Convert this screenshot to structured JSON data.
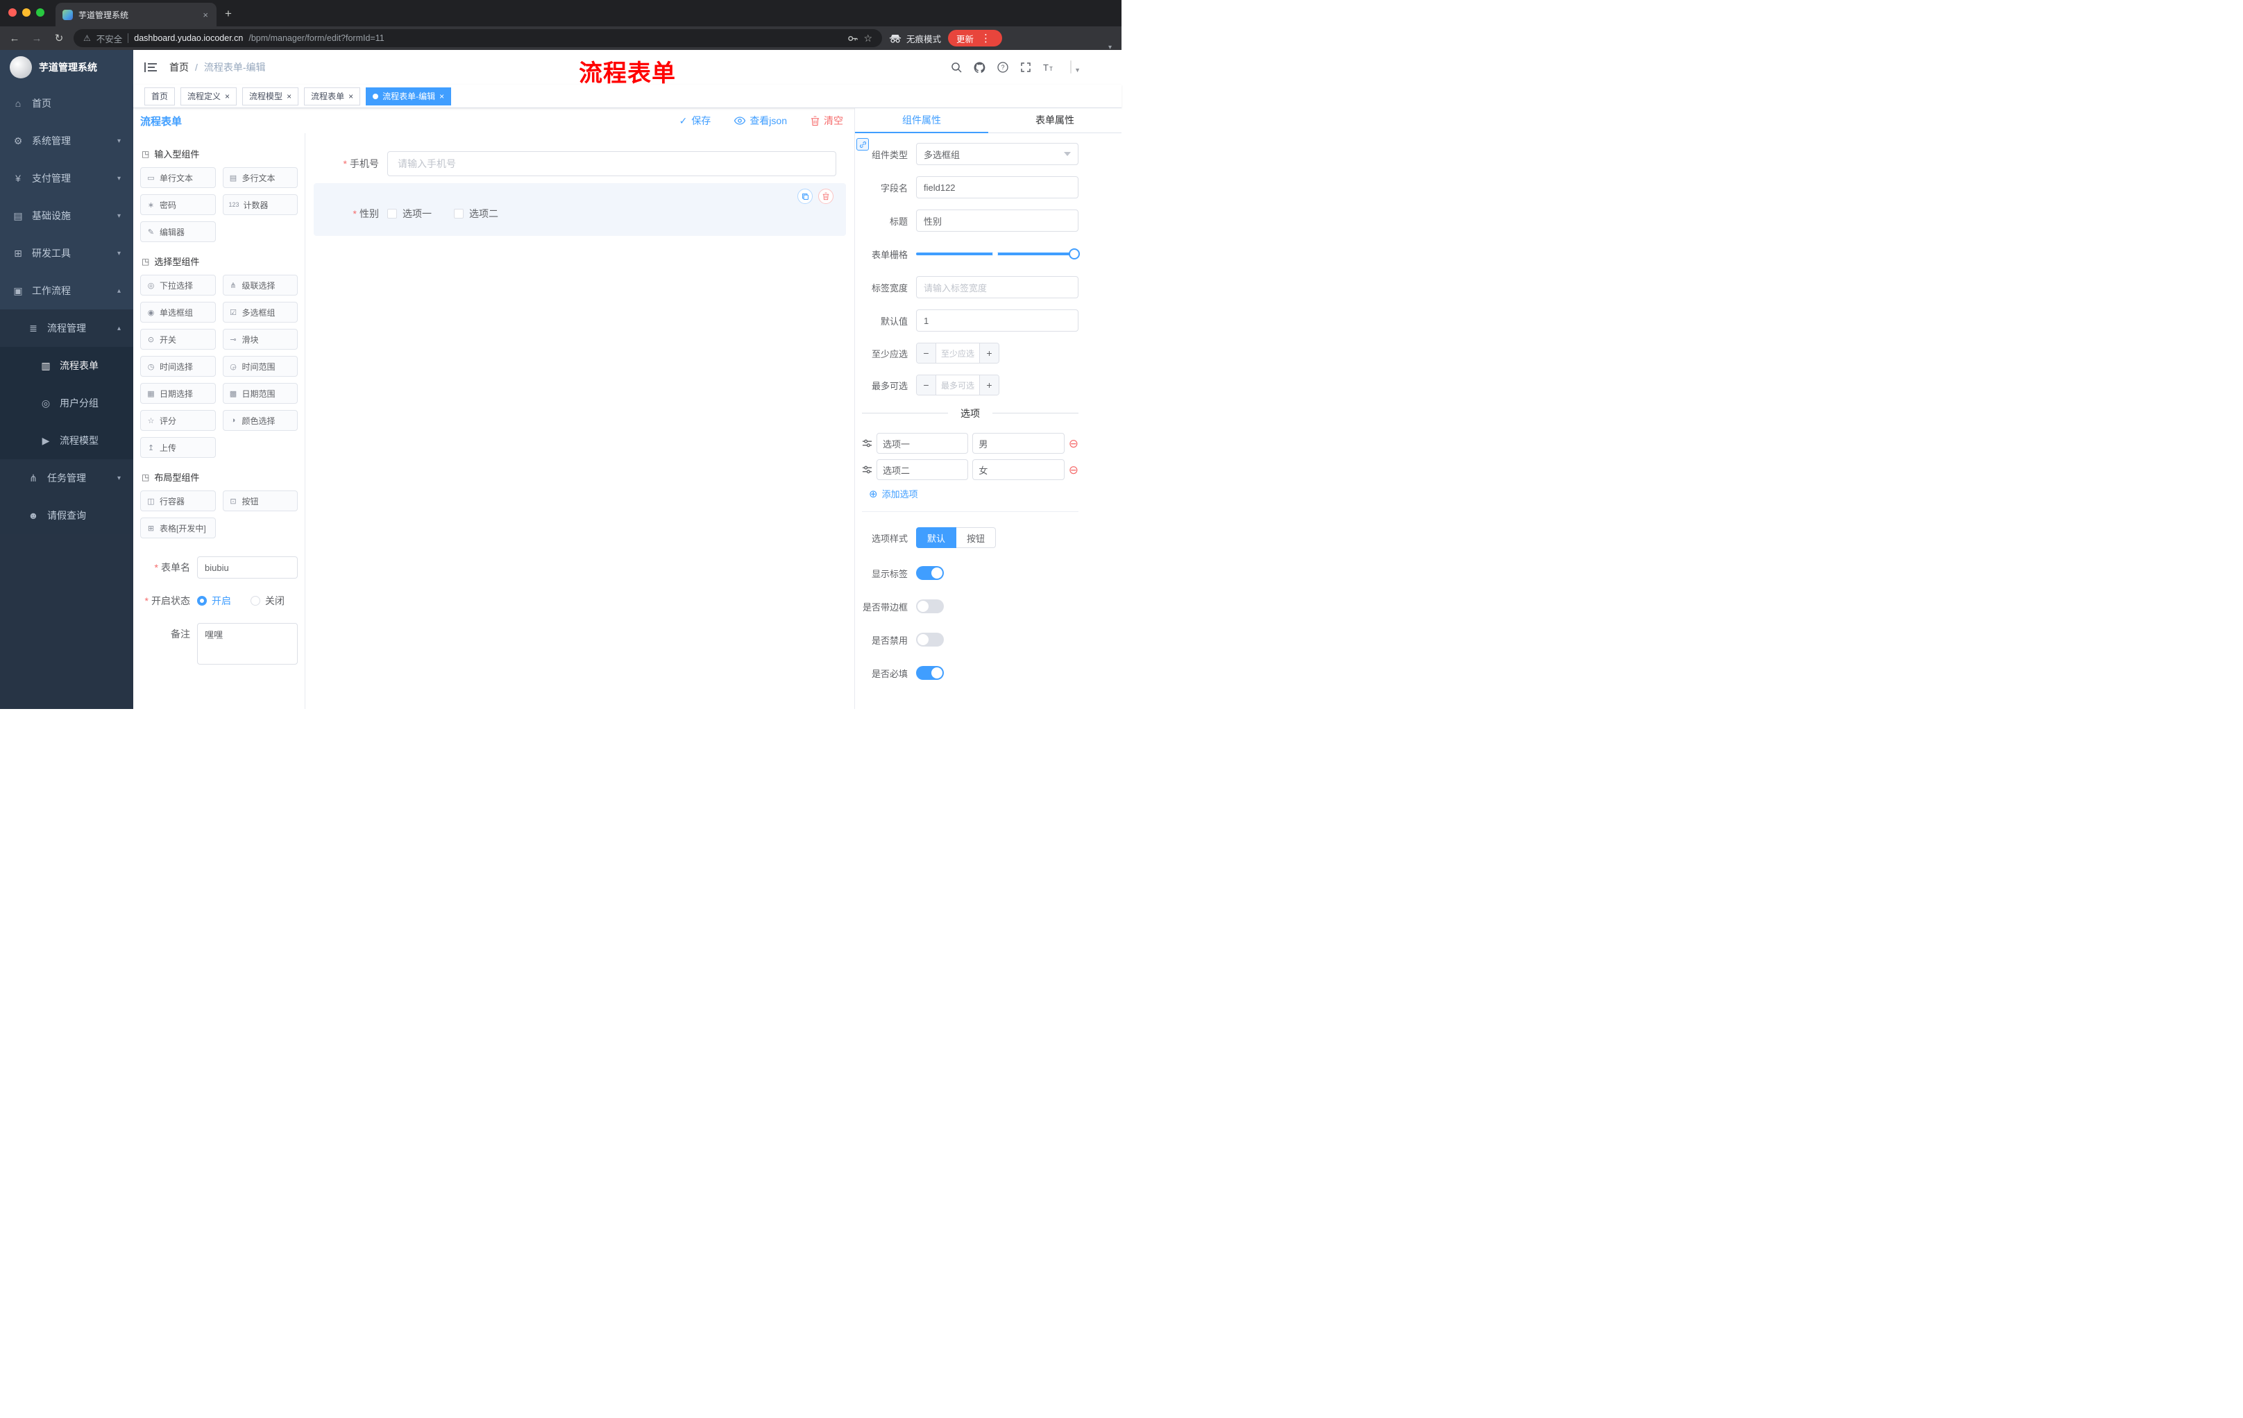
{
  "browser": {
    "tab_title": "芋道管理系统",
    "security_label": "不安全",
    "url_host": "dashboard.yudao.iocoder.cn",
    "url_path": "/bpm/manager/form/edit?formId=11",
    "incognito_label": "无痕模式",
    "update_label": "更新"
  },
  "header": {
    "breadcrumb_home": "首页",
    "breadcrumb_sep": "/",
    "breadcrumb_current": "流程表单-编辑",
    "annotation": "流程表单"
  },
  "tags": [
    {
      "label": "首页",
      "closable": false,
      "active": false
    },
    {
      "label": "流程定义",
      "closable": true,
      "active": false
    },
    {
      "label": "流程模型",
      "closable": true,
      "active": false
    },
    {
      "label": "流程表单",
      "closable": true,
      "active": false
    },
    {
      "label": "流程表单-编辑",
      "closable": true,
      "active": true
    }
  ],
  "sidebar": {
    "title": "芋道管理系统",
    "items": [
      {
        "label": "首页",
        "glyph": "⌂"
      },
      {
        "label": "系统管理",
        "glyph": "⚙"
      },
      {
        "label": "支付管理",
        "glyph": "¥"
      },
      {
        "label": "基础设施",
        "glyph": "▤"
      },
      {
        "label": "研发工具",
        "glyph": "⊞"
      },
      {
        "label": "工作流程",
        "glyph": "▣"
      },
      {
        "label": "流程管理",
        "glyph": "≣"
      },
      {
        "label": "流程表单",
        "glyph": "▥"
      },
      {
        "label": "用户分组",
        "glyph": "◎"
      },
      {
        "label": "流程模型",
        "glyph": "▶"
      },
      {
        "label": "任务管理",
        "glyph": "⋔"
      },
      {
        "label": "请假查询",
        "glyph": "☻"
      }
    ]
  },
  "designer": {
    "title": "流程表单",
    "save": "保存",
    "view_json": "查看json",
    "clear": "清空"
  },
  "palette": {
    "sections": [
      {
        "title": "输入型组件",
        "items": [
          {
            "label": "单行文本",
            "glyph": "▭"
          },
          {
            "label": "多行文本",
            "glyph": "▤"
          },
          {
            "label": "密码",
            "glyph": "∗"
          },
          {
            "label": "计数器",
            "glyph": "123"
          },
          {
            "label": "编辑器",
            "glyph": "✎"
          }
        ]
      },
      {
        "title": "选择型组件",
        "items": [
          {
            "label": "下拉选择",
            "glyph": "◎"
          },
          {
            "label": "级联选择",
            "glyph": "⋔"
          },
          {
            "label": "单选框组",
            "glyph": "◉"
          },
          {
            "label": "多选框组",
            "glyph": "☑"
          },
          {
            "label": "开关",
            "glyph": "⊙"
          },
          {
            "label": "滑块",
            "glyph": "⊸"
          },
          {
            "label": "时间选择",
            "glyph": "◷"
          },
          {
            "label": "时间范围",
            "glyph": "◶"
          },
          {
            "label": "日期选择",
            "glyph": "▦"
          },
          {
            "label": "日期范围",
            "glyph": "▩"
          },
          {
            "label": "评分",
            "glyph": "☆"
          },
          {
            "label": "颜色选择",
            "glyph": "◑"
          },
          {
            "label": "上传",
            "glyph": "↥"
          }
        ]
      },
      {
        "title": "布局型组件",
        "items": [
          {
            "label": "行容器",
            "glyph": "◫"
          },
          {
            "label": "按钮",
            "glyph": "⊡"
          },
          {
            "label": "表格[开发中]",
            "glyph": "⊞"
          }
        ]
      }
    ],
    "form": {
      "name_label": "表单名",
      "name_value": "biubiu",
      "status_label": "开启状态",
      "status_on": "开启",
      "status_off": "关闭",
      "status_selected": "开启",
      "remark_label": "备注",
      "remark_value": "嘿嘿"
    }
  },
  "canvas": {
    "phone_label": "手机号",
    "phone_placeholder": "请输入手机号",
    "gender_label": "性别",
    "gender_options": [
      "选项一",
      "选项二"
    ]
  },
  "props": {
    "tab_component": "组件属性",
    "tab_form": "表单属性",
    "type_label": "组件类型",
    "type_value": "多选框组",
    "field_label": "字段名",
    "field_value": "field122",
    "title_label": "标题",
    "title_value": "性别",
    "grid_label": "表单栅格",
    "width_label": "标签宽度",
    "width_placeholder": "请输入标签宽度",
    "default_label": "默认值",
    "default_value": "1",
    "min_label": "至少应选",
    "min_placeholder": "至少应选",
    "max_label": "最多可选",
    "max_placeholder": "最多可选",
    "options_title": "选项",
    "options": [
      {
        "name": "选项一",
        "value": "男"
      },
      {
        "name": "选项二",
        "value": "女"
      }
    ],
    "add_option": "添加选项",
    "style_label": "选项样式",
    "style_default": "默认",
    "style_button": "按钮",
    "style_selected": "默认",
    "switch_rows": [
      {
        "label": "显示标签",
        "on": true
      },
      {
        "label": "是否带边框",
        "on": false
      },
      {
        "label": "是否禁用",
        "on": false
      },
      {
        "label": "是否必填",
        "on": true
      }
    ]
  },
  "colors": {
    "primary": "#409eff",
    "danger": "#f56c6c",
    "annotation": "#ff0000",
    "sidebar": "#304156"
  }
}
